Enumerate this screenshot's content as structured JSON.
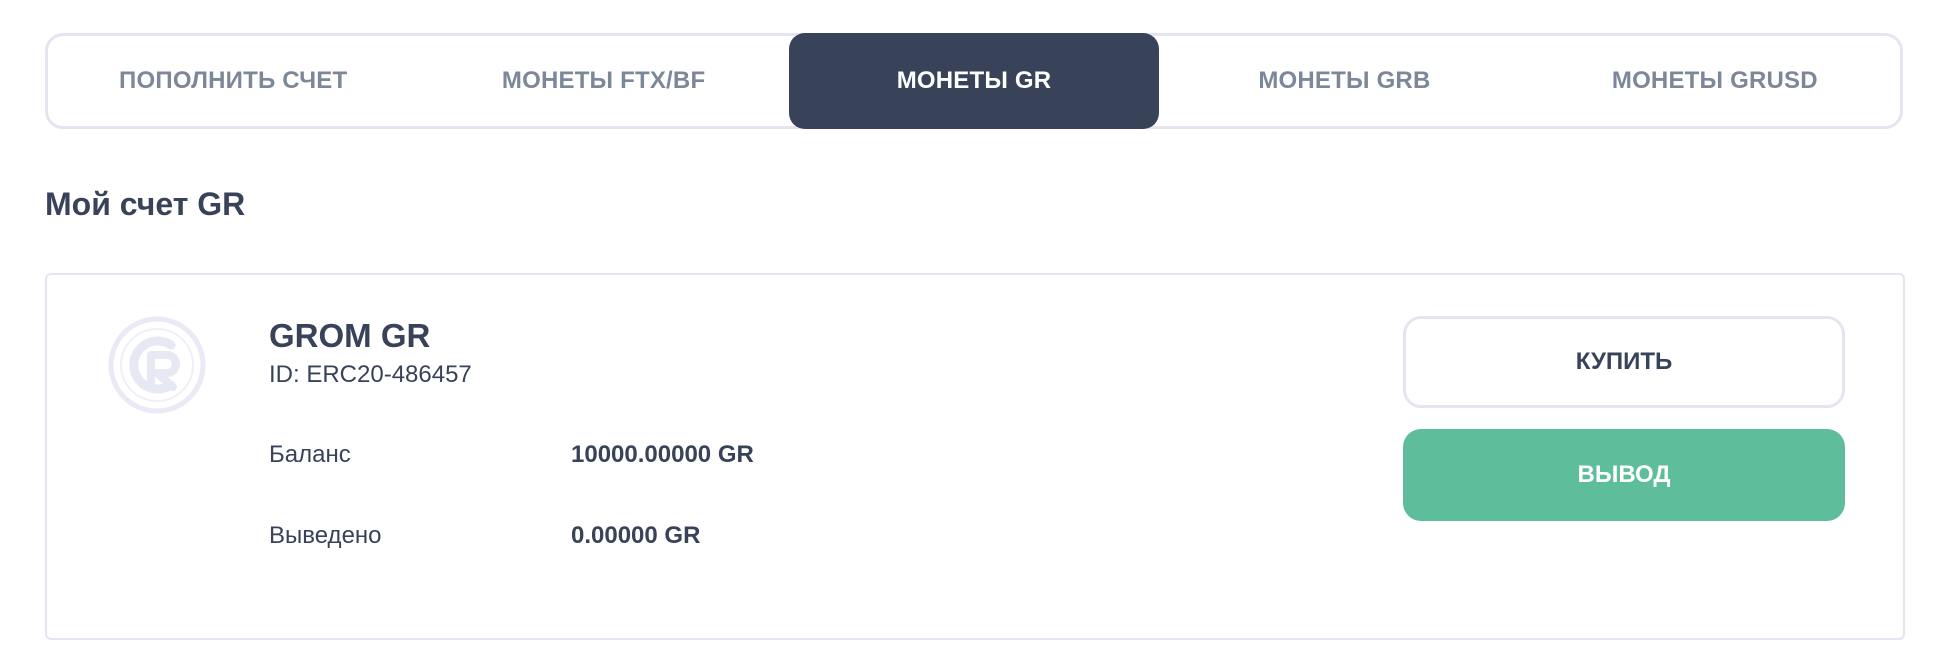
{
  "tabs": [
    {
      "label": "ПОПОЛНИТЬ СЧЕТ",
      "active": false
    },
    {
      "label": "МОНЕТЫ FTX/BF",
      "active": false
    },
    {
      "label": "МОНЕТЫ GR",
      "active": true
    },
    {
      "label": "МОНЕТЫ GRB",
      "active": false
    },
    {
      "label": "МОНЕТЫ GRUSD",
      "active": false
    }
  ],
  "section": {
    "title": "Мой счет GR"
  },
  "coin": {
    "logo_icon": "gr-logo-icon",
    "name": "GROM GR",
    "id_text": "ID: ERC20-486457",
    "balance_label": "Баланс",
    "balance_value": "10000.00000 GR",
    "withdrawn_label": "Выведено",
    "withdrawn_value": "0.00000 GR"
  },
  "actions": {
    "buy_label": "КУПИТЬ",
    "withdraw_label": "ВЫВОД"
  },
  "colors": {
    "primary_dark": "#384259",
    "muted_text": "#7d879a",
    "border": "#e4e5f0",
    "success": "#5ebe9b"
  }
}
